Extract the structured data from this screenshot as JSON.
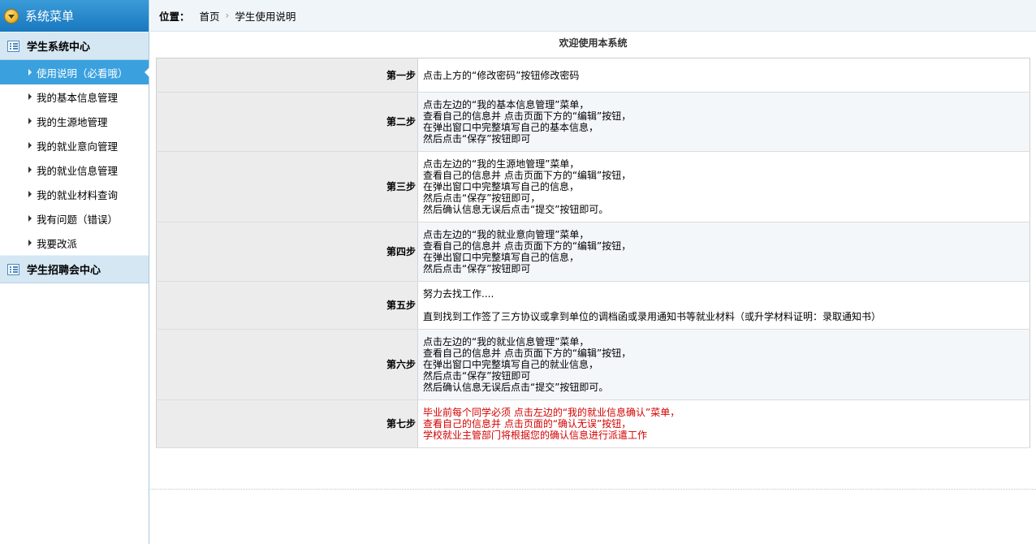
{
  "sidebar": {
    "header_title": "系统菜单",
    "groups": [
      {
        "title": "学生系统中心",
        "items": [
          {
            "label": "使用说明（必看哦）"
          },
          {
            "label": "我的基本信息管理"
          },
          {
            "label": "我的生源地管理"
          },
          {
            "label": "我的就业意向管理"
          },
          {
            "label": "我的就业信息管理"
          },
          {
            "label": "我的就业材料查询"
          },
          {
            "label": "我有问题（错误）"
          },
          {
            "label": "我要改派"
          }
        ]
      },
      {
        "title": "学生招聘会中心",
        "items": []
      }
    ]
  },
  "breadcrumb": {
    "label": "位置：",
    "items": [
      "首页",
      "学生使用说明"
    ],
    "separator": "›"
  },
  "main": {
    "welcome": "欢迎使用本系统",
    "steps": [
      {
        "label": "第一步",
        "lines": [
          "点击上方的“修改密码”按钮修改密码"
        ]
      },
      {
        "label": "第二步",
        "lines": [
          "点击左边的“我的基本信息管理”菜单，",
          "查看自己的信息并 点击页面下方的“编辑”按钮，",
          "在弹出窗口中完整填写自己的基本信息，",
          "然后点击“保存”按钮即可"
        ]
      },
      {
        "label": "第三步",
        "lines": [
          "点击左边的“我的生源地管理”菜单，",
          "查看自己的信息并 点击页面下方的“编辑”按钮，",
          "在弹出窗口中完整填写自己的信息，",
          "然后点击“保存”按钮即可，",
          "然后确认信息无误后点击“提交”按钮即可。"
        ]
      },
      {
        "label": "第四步",
        "lines": [
          "点击左边的“我的就业意向管理”菜单，",
          "查看自己的信息并 点击页面下方的“编辑”按钮，",
          "在弹出窗口中完整填写自己的信息，",
          "然后点击“保存”按钮即可"
        ]
      },
      {
        "label": "第五步",
        "lines": [
          "努力去找工作....",
          "直到找到工作签了三方协议或拿到单位的调档函或录用通知书等就业材料（或升学材料证明：录取通知书）"
        ]
      },
      {
        "label": "第六步",
        "lines": [
          "点击左边的“我的就业信息管理”菜单，",
          "查看自己的信息并 点击页面下方的“编辑”按钮，",
          "在弹出窗口中完整填写自己的就业信息，",
          "然后点击“保存”按钮即可",
          "然后确认信息无误后点击“提交”按钮即可。"
        ]
      },
      {
        "label": "第七步",
        "lines": [
          "毕业前每个同学必须 点击左边的“我的就业信息确认”菜单，",
          "查看自己的信息并 点击页面的“确认无误”按钮，",
          "学校就业主管部门将根据您的确认信息进行派遣工作"
        ]
      }
    ]
  },
  "colors": {
    "sidebar_header": "#1f82c8",
    "active_item": "#3ba1de",
    "group_header": "#d5e7f3",
    "highlight_text": "#d40000"
  },
  "icons": {
    "sidebar_header": "collapse-arrow-icon",
    "group": "list-icon",
    "menu_item": "triangle-right-icon"
  }
}
